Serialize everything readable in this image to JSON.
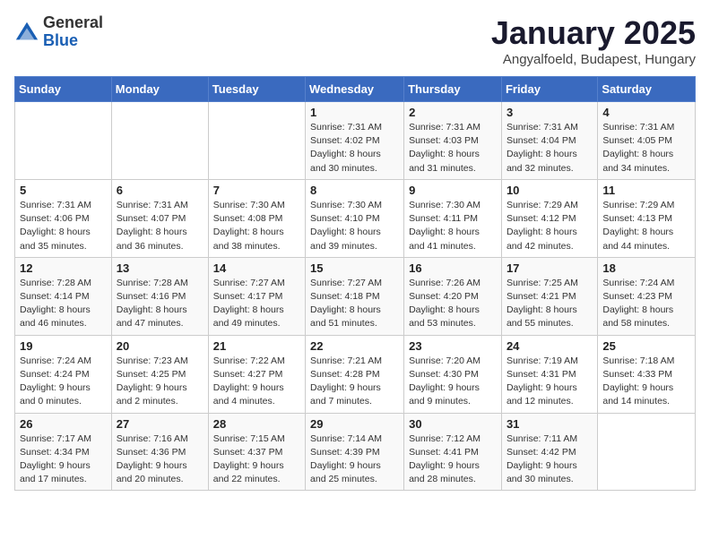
{
  "header": {
    "logo_general": "General",
    "logo_blue": "Blue",
    "month_title": "January 2025",
    "location": "Angyalfoeld, Budapest, Hungary"
  },
  "weekdays": [
    "Sunday",
    "Monday",
    "Tuesday",
    "Wednesday",
    "Thursday",
    "Friday",
    "Saturday"
  ],
  "weeks": [
    [
      {
        "day": "",
        "info": ""
      },
      {
        "day": "",
        "info": ""
      },
      {
        "day": "",
        "info": ""
      },
      {
        "day": "1",
        "info": "Sunrise: 7:31 AM\nSunset: 4:02 PM\nDaylight: 8 hours and 30 minutes."
      },
      {
        "day": "2",
        "info": "Sunrise: 7:31 AM\nSunset: 4:03 PM\nDaylight: 8 hours and 31 minutes."
      },
      {
        "day": "3",
        "info": "Sunrise: 7:31 AM\nSunset: 4:04 PM\nDaylight: 8 hours and 32 minutes."
      },
      {
        "day": "4",
        "info": "Sunrise: 7:31 AM\nSunset: 4:05 PM\nDaylight: 8 hours and 34 minutes."
      }
    ],
    [
      {
        "day": "5",
        "info": "Sunrise: 7:31 AM\nSunset: 4:06 PM\nDaylight: 8 hours and 35 minutes."
      },
      {
        "day": "6",
        "info": "Sunrise: 7:31 AM\nSunset: 4:07 PM\nDaylight: 8 hours and 36 minutes."
      },
      {
        "day": "7",
        "info": "Sunrise: 7:30 AM\nSunset: 4:08 PM\nDaylight: 8 hours and 38 minutes."
      },
      {
        "day": "8",
        "info": "Sunrise: 7:30 AM\nSunset: 4:10 PM\nDaylight: 8 hours and 39 minutes."
      },
      {
        "day": "9",
        "info": "Sunrise: 7:30 AM\nSunset: 4:11 PM\nDaylight: 8 hours and 41 minutes."
      },
      {
        "day": "10",
        "info": "Sunrise: 7:29 AM\nSunset: 4:12 PM\nDaylight: 8 hours and 42 minutes."
      },
      {
        "day": "11",
        "info": "Sunrise: 7:29 AM\nSunset: 4:13 PM\nDaylight: 8 hours and 44 minutes."
      }
    ],
    [
      {
        "day": "12",
        "info": "Sunrise: 7:28 AM\nSunset: 4:14 PM\nDaylight: 8 hours and 46 minutes."
      },
      {
        "day": "13",
        "info": "Sunrise: 7:28 AM\nSunset: 4:16 PM\nDaylight: 8 hours and 47 minutes."
      },
      {
        "day": "14",
        "info": "Sunrise: 7:27 AM\nSunset: 4:17 PM\nDaylight: 8 hours and 49 minutes."
      },
      {
        "day": "15",
        "info": "Sunrise: 7:27 AM\nSunset: 4:18 PM\nDaylight: 8 hours and 51 minutes."
      },
      {
        "day": "16",
        "info": "Sunrise: 7:26 AM\nSunset: 4:20 PM\nDaylight: 8 hours and 53 minutes."
      },
      {
        "day": "17",
        "info": "Sunrise: 7:25 AM\nSunset: 4:21 PM\nDaylight: 8 hours and 55 minutes."
      },
      {
        "day": "18",
        "info": "Sunrise: 7:24 AM\nSunset: 4:23 PM\nDaylight: 8 hours and 58 minutes."
      }
    ],
    [
      {
        "day": "19",
        "info": "Sunrise: 7:24 AM\nSunset: 4:24 PM\nDaylight: 9 hours and 0 minutes."
      },
      {
        "day": "20",
        "info": "Sunrise: 7:23 AM\nSunset: 4:25 PM\nDaylight: 9 hours and 2 minutes."
      },
      {
        "day": "21",
        "info": "Sunrise: 7:22 AM\nSunset: 4:27 PM\nDaylight: 9 hours and 4 minutes."
      },
      {
        "day": "22",
        "info": "Sunrise: 7:21 AM\nSunset: 4:28 PM\nDaylight: 9 hours and 7 minutes."
      },
      {
        "day": "23",
        "info": "Sunrise: 7:20 AM\nSunset: 4:30 PM\nDaylight: 9 hours and 9 minutes."
      },
      {
        "day": "24",
        "info": "Sunrise: 7:19 AM\nSunset: 4:31 PM\nDaylight: 9 hours and 12 minutes."
      },
      {
        "day": "25",
        "info": "Sunrise: 7:18 AM\nSunset: 4:33 PM\nDaylight: 9 hours and 14 minutes."
      }
    ],
    [
      {
        "day": "26",
        "info": "Sunrise: 7:17 AM\nSunset: 4:34 PM\nDaylight: 9 hours and 17 minutes."
      },
      {
        "day": "27",
        "info": "Sunrise: 7:16 AM\nSunset: 4:36 PM\nDaylight: 9 hours and 20 minutes."
      },
      {
        "day": "28",
        "info": "Sunrise: 7:15 AM\nSunset: 4:37 PM\nDaylight: 9 hours and 22 minutes."
      },
      {
        "day": "29",
        "info": "Sunrise: 7:14 AM\nSunset: 4:39 PM\nDaylight: 9 hours and 25 minutes."
      },
      {
        "day": "30",
        "info": "Sunrise: 7:12 AM\nSunset: 4:41 PM\nDaylight: 9 hours and 28 minutes."
      },
      {
        "day": "31",
        "info": "Sunrise: 7:11 AM\nSunset: 4:42 PM\nDaylight: 9 hours and 30 minutes."
      },
      {
        "day": "",
        "info": ""
      }
    ]
  ]
}
